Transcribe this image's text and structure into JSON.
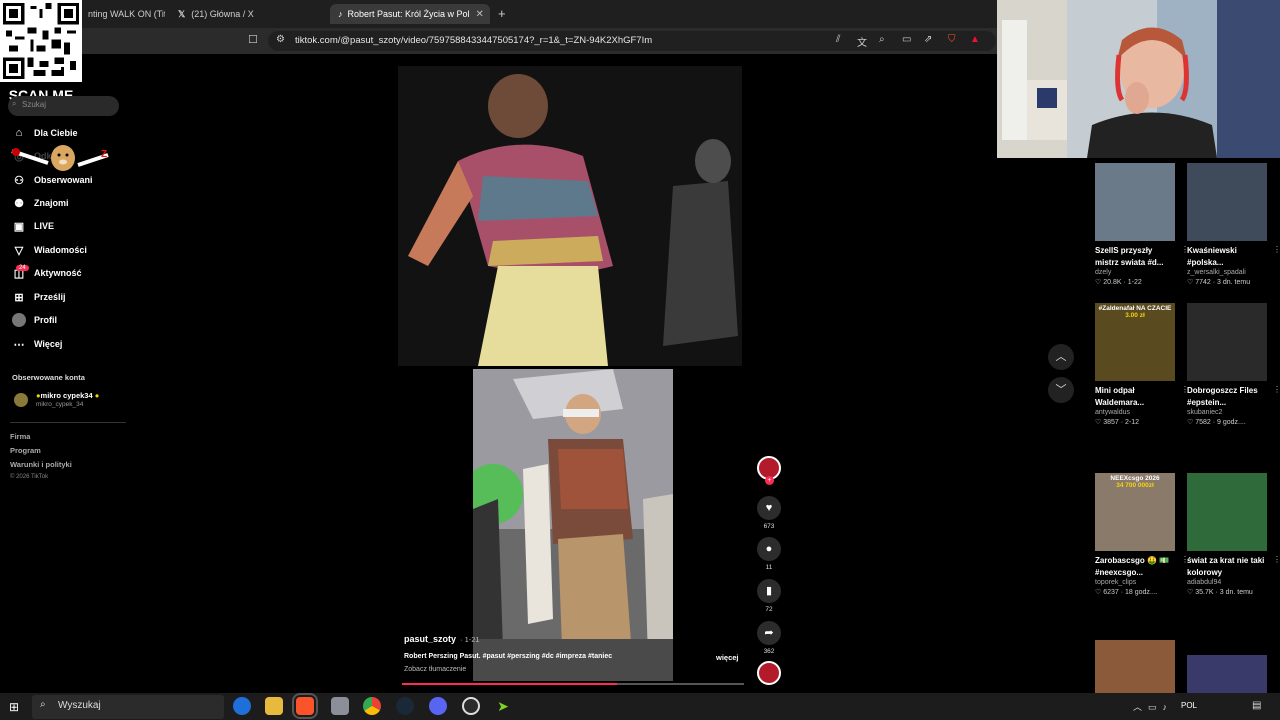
{
  "browser": {
    "tabs": [
      {
        "title": "nting WALK ON (Tita"
      },
      {
        "title": "(21) Główna / X"
      },
      {
        "title": "Robert Pasut: Król Życia w Pol"
      }
    ],
    "url": "tiktok.com/@pasut_szoty/video/7597588433447505174?_r=1&_t=ZN-94K2XhGF7Im"
  },
  "overlay": {
    "scan_me": "SCAN ME"
  },
  "sidebar": {
    "search_placeholder": "Szukaj",
    "items": [
      {
        "label": "Dla Ciebie",
        "icon": "home-icon"
      },
      {
        "label": "Odkrywaj",
        "icon": "compass-icon"
      },
      {
        "label": "Obserwowani",
        "icon": "user-follow-icon"
      },
      {
        "label": "Znajomi",
        "icon": "friends-icon"
      },
      {
        "label": "LIVE",
        "icon": "live-icon"
      },
      {
        "label": "Wiadomości",
        "icon": "message-icon"
      },
      {
        "label": "Aktywność",
        "icon": "activity-icon"
      },
      {
        "label": "Prześlij",
        "icon": "upload-icon"
      },
      {
        "label": "Profil",
        "icon": "profile-icon"
      },
      {
        "label": "Więcej",
        "icon": "more-icon"
      }
    ],
    "activity_badge": "24",
    "following_header": "Obserwowane konta",
    "following": {
      "name": "mikro cypek34",
      "handle": "mikro_cypek_34"
    },
    "footer": [
      "Firma",
      "Program",
      "Warunki i polityki"
    ],
    "copyright": "© 2026 TikTok"
  },
  "video": {
    "author": "pasut_szoty",
    "time": "· 1-21",
    "description": "Robert Perszing Pasut. #pasut #perszing #dc #impreza #taniec",
    "more": "więcej",
    "translate": "Zobacz tłumaczenie",
    "progress": 0.63,
    "likes": "673",
    "comments": "11",
    "saves": "72",
    "shares": "362"
  },
  "recommendations": [
    {
      "title": "SzellS przyszły mistrz swiata #d...",
      "handle": "dzely",
      "meta": "♡ 20.8K · 1-22",
      "thumb": "#6b7a88"
    },
    {
      "title": "Kwaśniewski #polska...",
      "handle": "z_wersalki_spadali",
      "meta": "♡ 7742 · 3 dn. temu",
      "thumb": "#3f4a5a"
    },
    {
      "title": "Mini odpał Waldemara...",
      "handle": "antywaldus",
      "meta": "♡ 3857 · 2-12",
      "thumb": "#5a4a20",
      "overlay": "#Zaldenafał NA CZACIE",
      "overlay2": "3.00 zł"
    },
    {
      "title": "Dobrogoszcz Files #epstein...",
      "handle": "skubaniec2",
      "meta": "♡ 7582 · 9 godz....",
      "thumb": "#2a2a2a"
    },
    {
      "title": "Zarobascsgo 🤑 💵 #neexcsgo...",
      "handle": "toporek_clips",
      "meta": "♡ 6237 · 18 godz....",
      "thumb": "#8a7a6a",
      "overlay": "NEEXcsgo 2026",
      "overlay2": "34 700 000zł"
    },
    {
      "title": "świat za krat nie taki kolorowy",
      "handle": "adiabdul94",
      "meta": "♡ 35.7K · 3 dn. temu",
      "thumb": "#2f6a3a"
    }
  ],
  "taskbar": {
    "search": "Wyszukaj",
    "lang": "POL"
  }
}
